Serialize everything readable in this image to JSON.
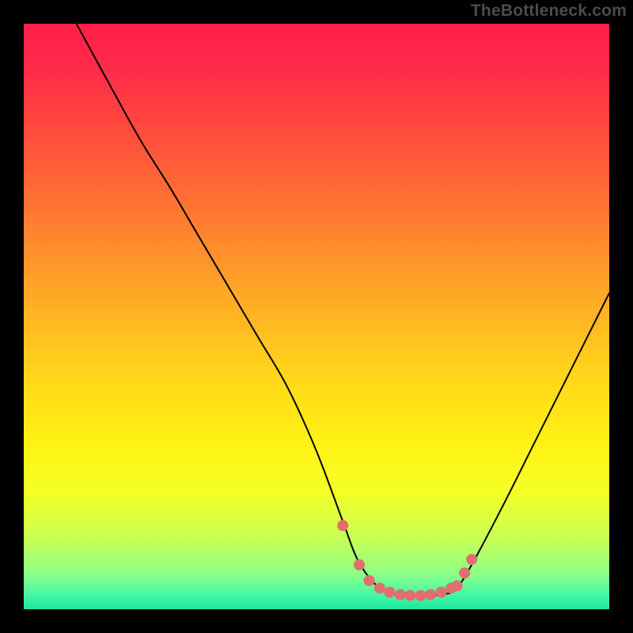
{
  "watermark": "TheBottleneck.com",
  "chart_data": {
    "type": "line",
    "title": "",
    "xlabel": "",
    "ylabel": "",
    "xlim": [
      0,
      100
    ],
    "ylim": [
      0,
      100
    ],
    "background_gradient_stops": [
      {
        "offset": 0.0,
        "color": "#ff1f4a"
      },
      {
        "offset": 0.07,
        "color": "#ff2a49"
      },
      {
        "offset": 0.18,
        "color": "#ff4a3d"
      },
      {
        "offset": 0.3,
        "color": "#ff7034"
      },
      {
        "offset": 0.45,
        "color": "#ffa427"
      },
      {
        "offset": 0.6,
        "color": "#ffd61a"
      },
      {
        "offset": 0.72,
        "color": "#fff314"
      },
      {
        "offset": 0.8,
        "color": "#f5ff26"
      },
      {
        "offset": 0.88,
        "color": "#c7ff55"
      },
      {
        "offset": 0.94,
        "color": "#8dff88"
      },
      {
        "offset": 0.975,
        "color": "#46f7a6"
      },
      {
        "offset": 1.0,
        "color": "#1fe7a0"
      }
    ],
    "series": [
      {
        "name": "bottleneck-curve",
        "color": "#000000",
        "stroke_width": 2,
        "x": [
          9,
          15,
          20,
          25,
          30,
          35,
          40,
          45,
          50,
          54.5,
          57,
          60,
          63,
          66,
          69,
          72,
          74,
          77,
          82,
          87,
          92,
          97,
          100
        ],
        "y": [
          100,
          89,
          80,
          72,
          63.5,
          55,
          46.5,
          38,
          27,
          15,
          8.5,
          4.3,
          2.6,
          2.35,
          2.35,
          2.6,
          3.6,
          8.5,
          18,
          28,
          38,
          48,
          54
        ]
      },
      {
        "name": "optimal-zone-marker",
        "type": "scatter",
        "color": "#e06f6d",
        "marker_radius": 7,
        "x": [
          54.5,
          57.3,
          59.0,
          60.8,
          62.5,
          64.3,
          66.0,
          67.8,
          69.5,
          71.3,
          73.0,
          74.0,
          75.3,
          76.5
        ],
        "y": [
          14.3,
          7.6,
          4.9,
          3.6,
          2.9,
          2.5,
          2.35,
          2.35,
          2.5,
          2.9,
          3.6,
          4.0,
          6.2,
          8.5
        ]
      }
    ]
  }
}
